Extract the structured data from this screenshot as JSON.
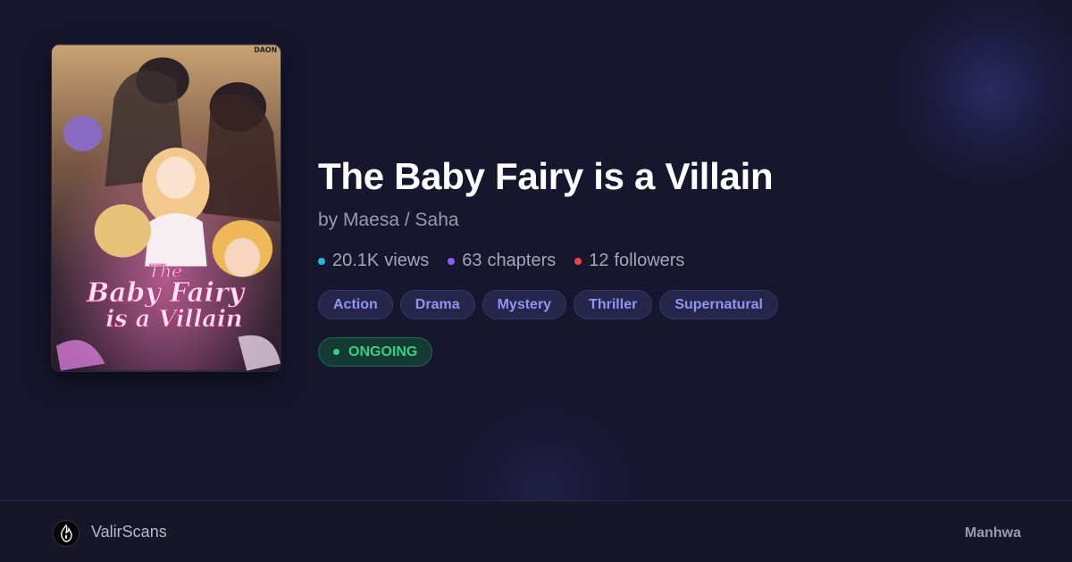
{
  "series": {
    "title": "The Baby Fairy is a Villain",
    "author": "by Maesa / Saha",
    "cover": {
      "title_line1": "The",
      "title_line2": "Baby Fairy",
      "title_line3": "is a Villain",
      "publisher_mark": "DAON"
    },
    "stats": [
      {
        "value": "20.1K",
        "label": "views",
        "color": "#22b5d8"
      },
      {
        "value": "63",
        "label": "chapters",
        "color": "#8b5cf6"
      },
      {
        "value": "12",
        "label": "followers",
        "color": "#ef4444"
      }
    ],
    "genres": [
      "Action",
      "Drama",
      "Mystery",
      "Thriller",
      "Supernatural"
    ],
    "status": "ONGOING"
  },
  "footer": {
    "site_name": "ValirScans",
    "type": "Manhwa"
  },
  "colors": {
    "background": "#17162f",
    "tag_text": "#8e95f2",
    "status_green": "#35d07d"
  }
}
